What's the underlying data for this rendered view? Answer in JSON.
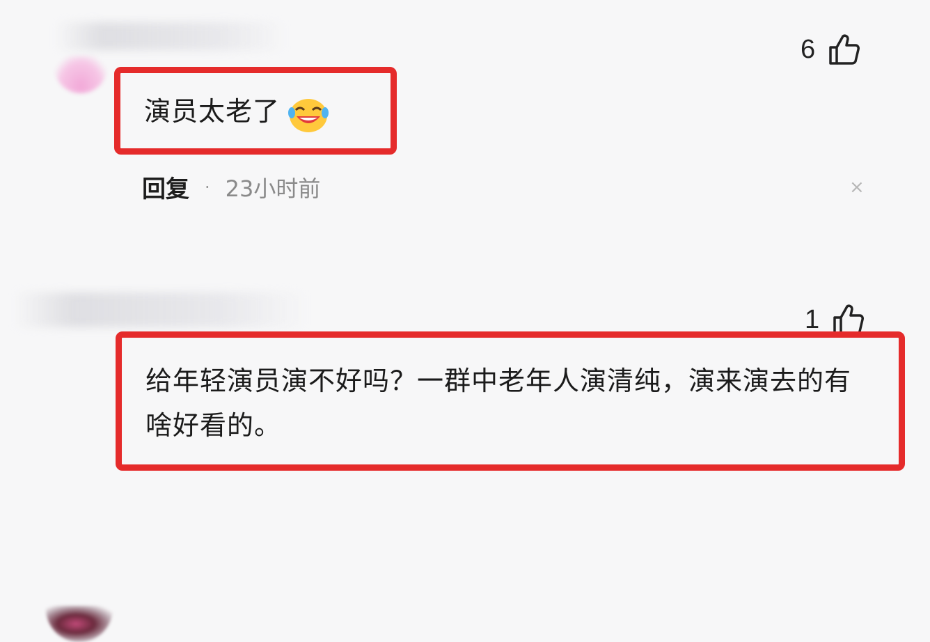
{
  "comments": [
    {
      "text": "演员太老了",
      "emoji_icon": "laughing-tears-icon",
      "like_count": "6",
      "reply_label": "回复",
      "separator": "·",
      "time_ago": "23小时前",
      "close_symbol": "×",
      "highlight_color": "#e52b2b"
    },
    {
      "text": "给年轻演员演不好吗？一群中老年人演清纯，演来演去的有啥好看的。",
      "like_count": "1",
      "highlight_color": "#e52b2b"
    }
  ]
}
